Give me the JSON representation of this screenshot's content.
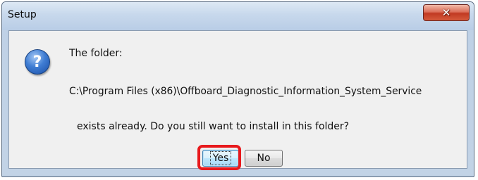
{
  "window": {
    "title": "Setup",
    "close_glyph": "✕"
  },
  "dialog": {
    "icon": "question-icon",
    "icon_glyph": "?",
    "line1": "The folder:",
    "path": "C:\\Program Files (x86)\\Offboard_Diagnostic_Information_System_Service",
    "question": "exists already. Do you still want to install in this folder?",
    "buttons": {
      "yes_label": "Yes",
      "no_label": "No"
    }
  },
  "colors": {
    "highlight": "#e8191c",
    "icon_blue": "#3f7dd3"
  }
}
